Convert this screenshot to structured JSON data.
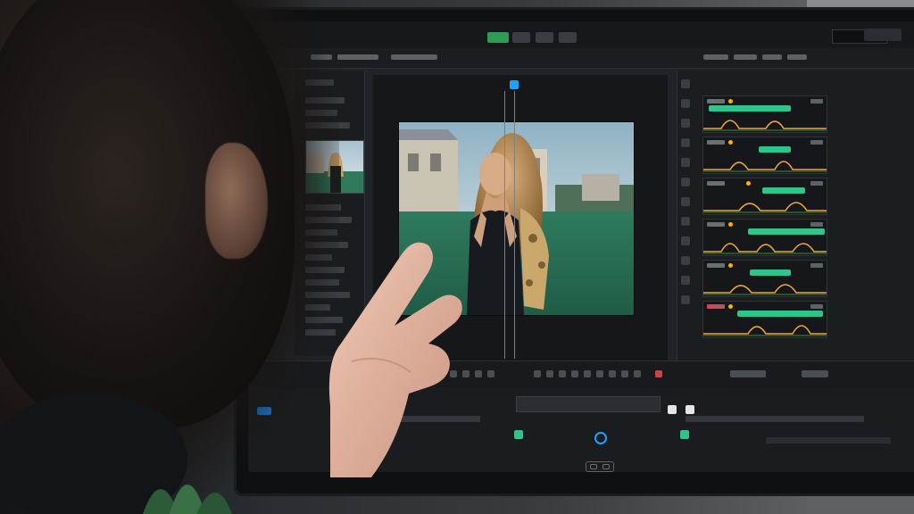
{
  "scene": {
    "kind": "person-pointing-at-video-editing-monitor",
    "accent_colors": {
      "play_green": "#2f9c55",
      "clip_green": "#2ec48a",
      "keyframe_orange": "#ffb000",
      "playhead_blue": "#1aa4ff",
      "record_red": "#d24141"
    },
    "icons": [
      "playhead-icon",
      "record-icon",
      "waveform-icon",
      "transform-gizmo-icon"
    ]
  },
  "editor": {
    "toolbar": {},
    "tracks_count": 6
  }
}
